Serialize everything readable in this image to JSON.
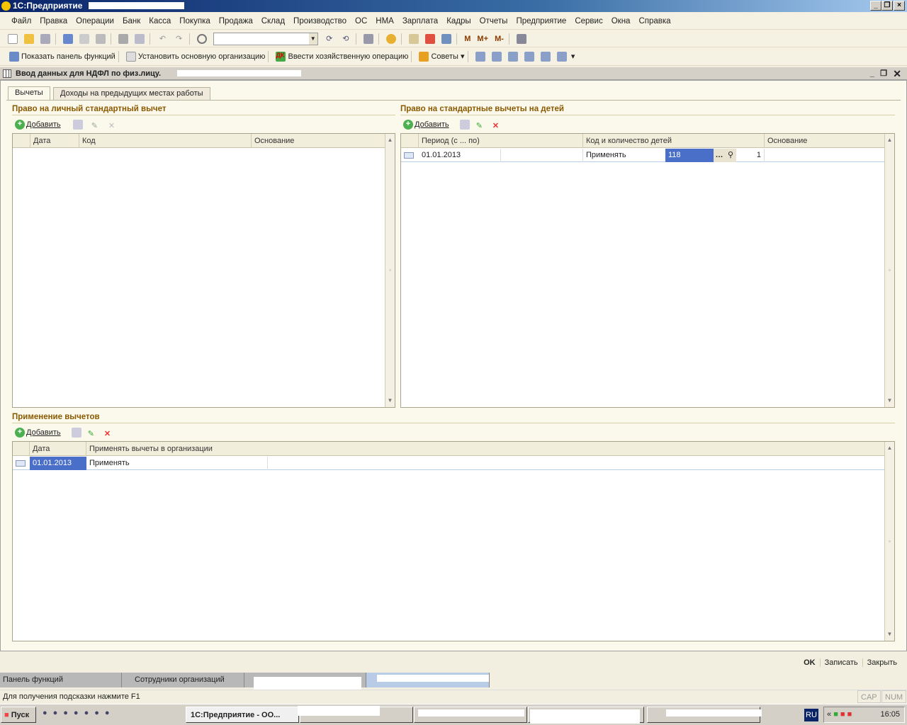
{
  "app": {
    "title": "1С:Предприятие",
    "logo": "1С"
  },
  "menu": [
    "Файл",
    "Правка",
    "Операции",
    "Банк",
    "Касса",
    "Покупка",
    "Продажа",
    "Склад",
    "Производство",
    "ОС",
    "НМА",
    "Зарплата",
    "Кадры",
    "Отчеты",
    "Предприятие",
    "Сервис",
    "Окна",
    "Справка"
  ],
  "toolbar2": {
    "show_panel": "Показать панель функций",
    "set_org": "Установить основную организацию",
    "enter_op": "Ввести хозяйственную операцию",
    "tips": "Советы"
  },
  "toolbar_calc": [
    "М",
    "М+",
    "М-"
  ],
  "document": {
    "title": "Ввод данных для НДФЛ по физ.лицу."
  },
  "tabs": [
    "Вычеты",
    "Доходы на предыдущих местах работы"
  ],
  "personal": {
    "title": "Право на личный стандартный вычет",
    "add": "Добавить",
    "columns": [
      "Дата",
      "Код",
      "Основание"
    ]
  },
  "children": {
    "title": "Право на стандартные вычеты на детей",
    "add": "Добавить",
    "columns": [
      "Период (с ... по)",
      "Код и количество детей",
      "Основание"
    ],
    "rows": [
      {
        "period": "01.01.2013",
        "mode": "Применять",
        "code": "118",
        "count": "1",
        "basis": ""
      }
    ]
  },
  "apply": {
    "title": "Применение вычетов",
    "add": "Добавить",
    "columns": [
      "Дата",
      "Применять вычеты в организации"
    ],
    "rows": [
      {
        "date": "01.01.2013",
        "mode": "Применять"
      }
    ]
  },
  "buttons": {
    "ok": "OK",
    "save": "Записать",
    "close": "Закрыть"
  },
  "window_tabs": [
    "Панель функций",
    "Сотрудники организаций"
  ],
  "status": {
    "hint": "Для получения подсказки нажмите F1",
    "cap": "CAP",
    "num": "NUM"
  },
  "taskbar": {
    "start": "Пуск",
    "task1": "1С:Предприятие - ОО...",
    "lang": "RU",
    "clock": "16:05"
  },
  "colors": {
    "titlebar": "#0a246a",
    "section_title": "#8b5a00",
    "selection": "#4a6fc8"
  }
}
